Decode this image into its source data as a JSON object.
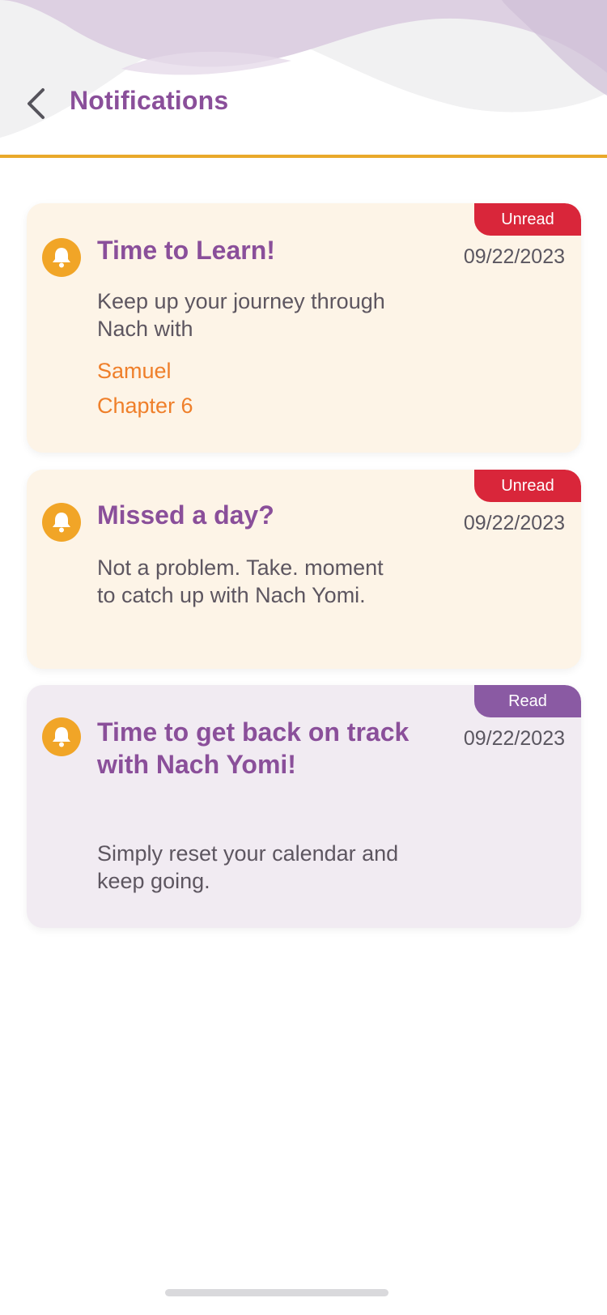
{
  "header": {
    "title": "Notifications",
    "back_icon": "chevron-left-icon",
    "accent_color": "#e9a92a"
  },
  "notifications": [
    {
      "title": "Time to Learn!",
      "date": "09/22/2023",
      "status": "Unread",
      "body": "Keep up your journey through Nach with",
      "links": [
        "Samuel",
        "Chapter 6"
      ],
      "icon": "bell-icon"
    },
    {
      "title": "Missed a day?",
      "date": "09/22/2023",
      "status": "Unread",
      "body": "Not a problem. Take. moment to catch up with Nach Yomi.",
      "icon": "bell-icon"
    },
    {
      "title": "Time to get back on track with Nach Yomi!",
      "date": "09/22/2023",
      "status": "Read",
      "body": "Simply reset your calendar and keep going.",
      "icon": "bell-icon"
    }
  ],
  "colors": {
    "title_purple": "#8a4f9a",
    "unread_badge": "#d9263a",
    "read_badge": "#8a5aa3",
    "bell_orange": "#f1a527",
    "link_orange": "#ef7f2a",
    "unread_card_bg": "#fdf4e7",
    "read_card_bg": "#f1ebf2"
  }
}
